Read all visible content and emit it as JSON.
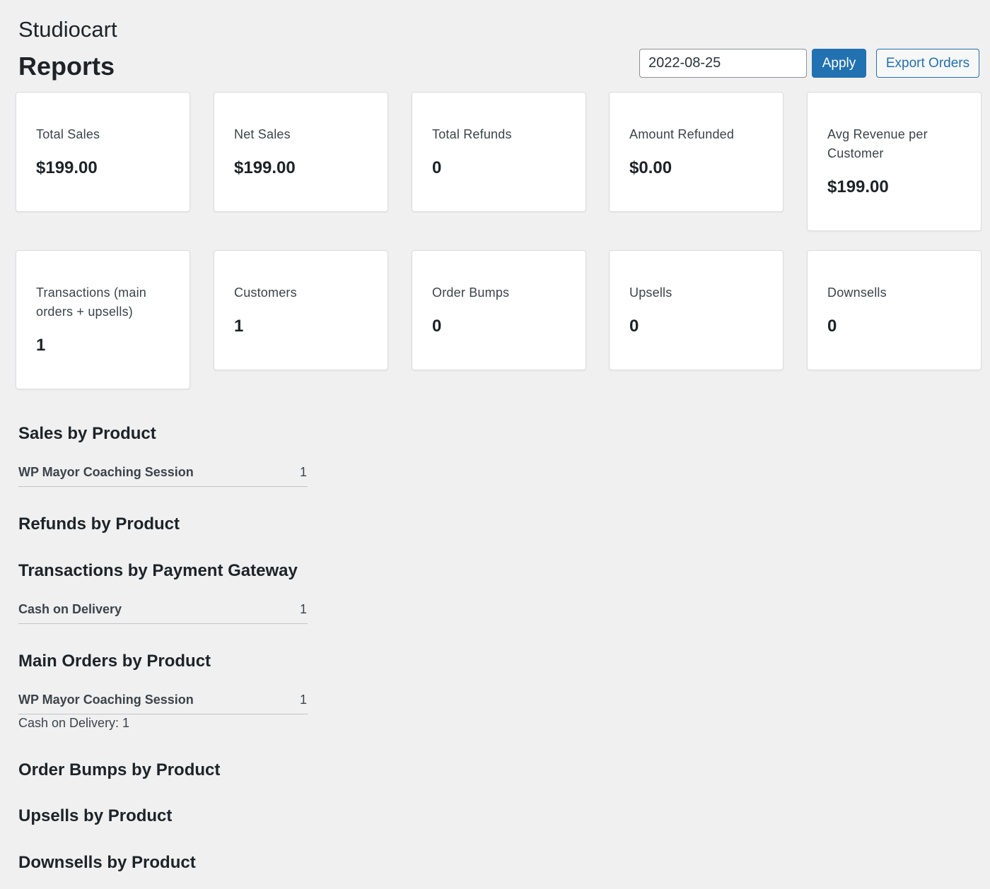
{
  "app": {
    "title": "Studiocart"
  },
  "page": {
    "title": "Reports"
  },
  "toolbar": {
    "date_value": "2022-08-25",
    "apply_label": "Apply",
    "export_label": "Export Orders"
  },
  "stats": [
    {
      "label": "Total Sales",
      "value": "$199.00"
    },
    {
      "label": "Net Sales",
      "value": "$199.00"
    },
    {
      "label": "Total Refunds",
      "value": "0"
    },
    {
      "label": "Amount Refunded",
      "value": "$0.00"
    },
    {
      "label": "Avg Revenue per Customer",
      "value": "$199.00"
    },
    {
      "label": "Transactions (main orders + upsells)",
      "value": "1"
    },
    {
      "label": "Customers",
      "value": "1"
    },
    {
      "label": "Order Bumps",
      "value": "0"
    },
    {
      "label": "Upsells",
      "value": "0"
    },
    {
      "label": "Downsells",
      "value": "0"
    }
  ],
  "sections": {
    "sales_by_product": {
      "heading": "Sales by Product",
      "rows": [
        {
          "name": "WP Mayor Coaching Session",
          "count": "1"
        }
      ]
    },
    "refunds_by_product": {
      "heading": "Refunds by Product"
    },
    "transactions_by_gateway": {
      "heading": "Transactions by Payment Gateway",
      "rows": [
        {
          "name": "Cash on Delivery",
          "count": "1"
        }
      ]
    },
    "main_orders_by_product": {
      "heading": "Main Orders by Product",
      "rows": [
        {
          "name": "WP Mayor Coaching Session",
          "count": "1",
          "note": "Cash on Delivery: 1"
        }
      ]
    },
    "order_bumps_by_product": {
      "heading": "Order Bumps by Product"
    },
    "upsells_by_product": {
      "heading": "Upsells by Product"
    },
    "downsells_by_product": {
      "heading": "Downsells by Product"
    }
  },
  "colors": {
    "background": "#f0f0f1",
    "primary": "#2271b1",
    "card": "#ffffff",
    "text": "#1d2327"
  }
}
